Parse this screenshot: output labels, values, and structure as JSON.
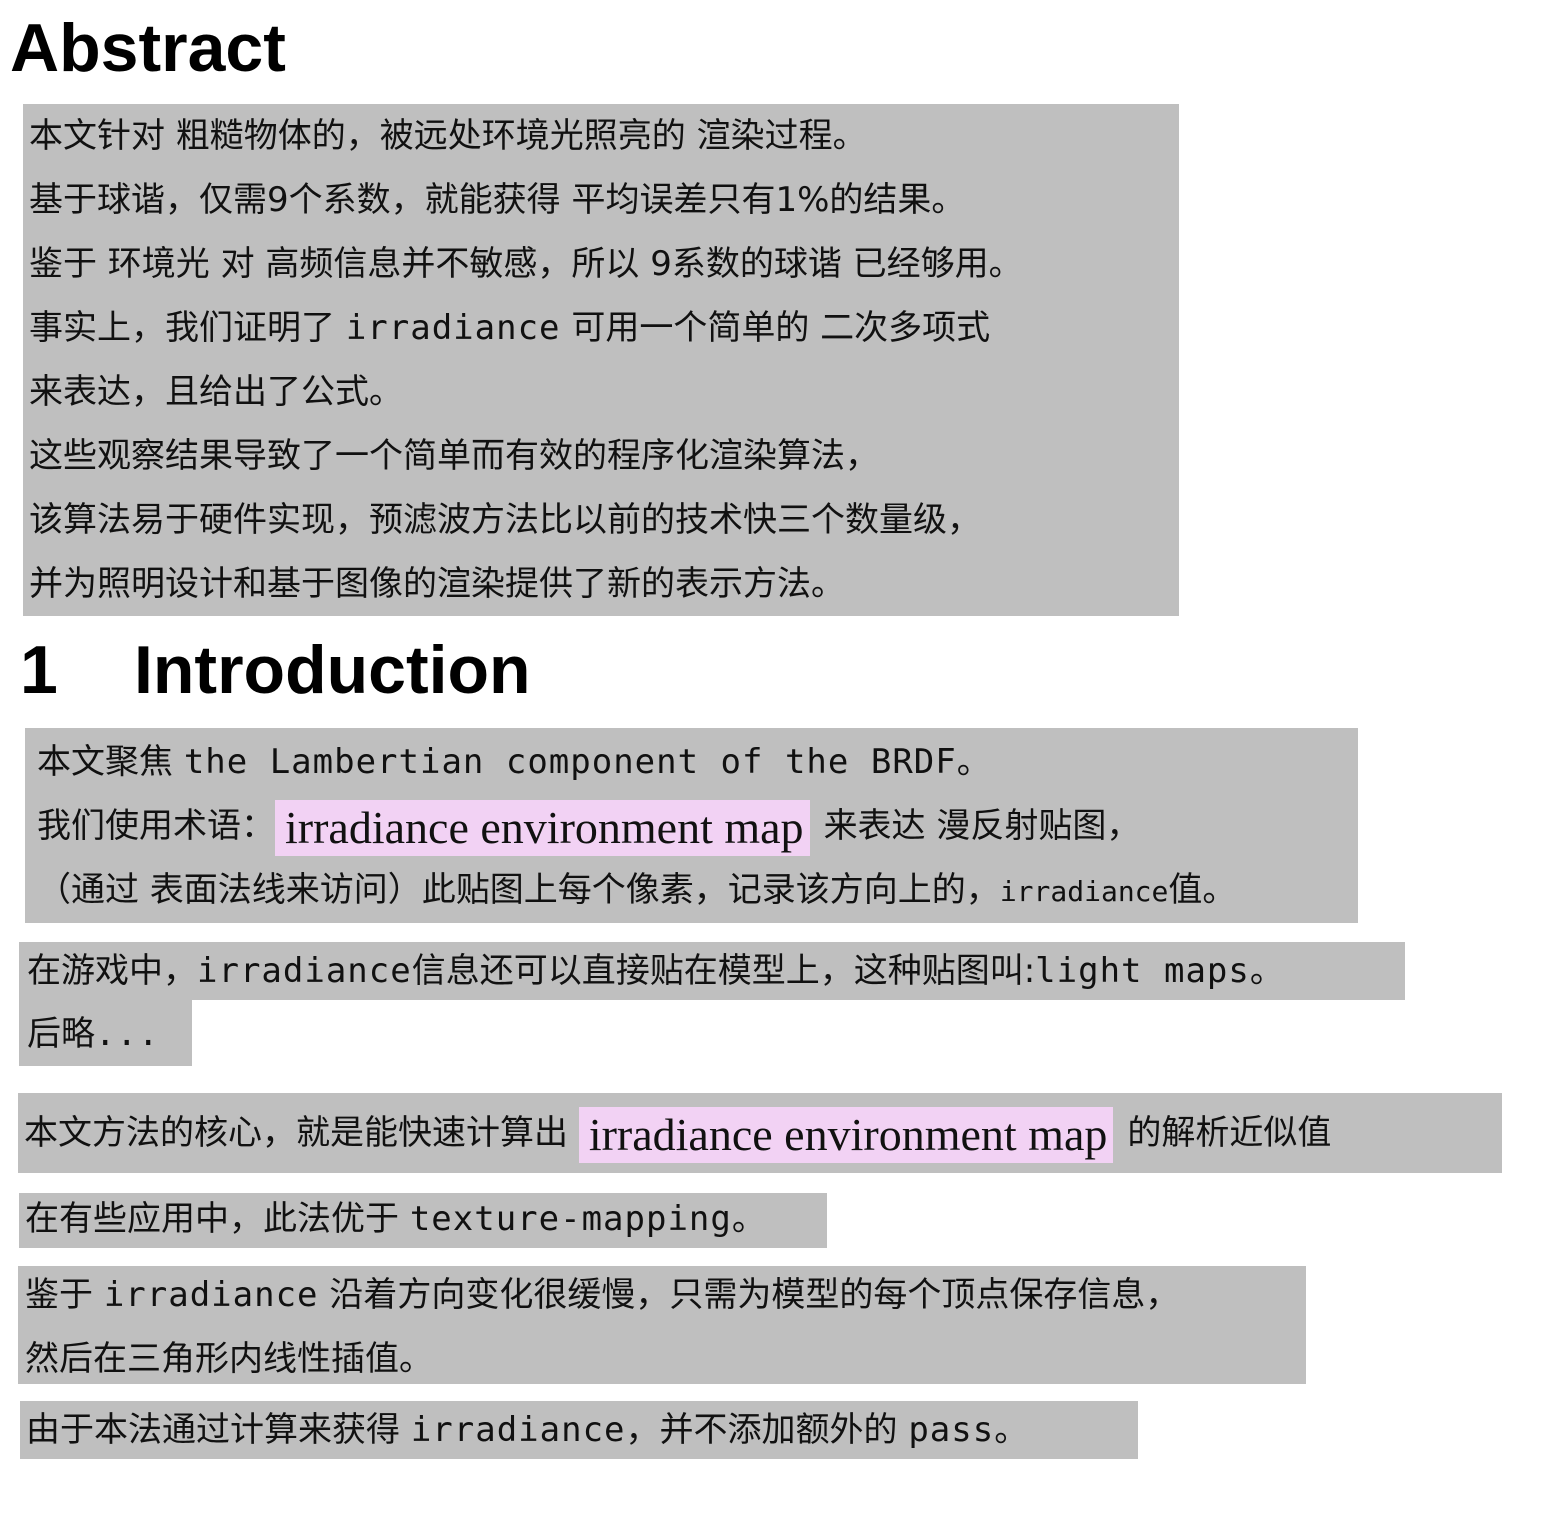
{
  "abstract": {
    "heading": "Abstract",
    "lines": [
      "本文针对 粗糙物体的，被远处环境光照亮的 渲染过程。",
      "基于球谐，仅需9个系数，就能获得 平均误差只有1%的结果。",
      "鉴于 环境光 对 高频信息并不敏感，所以 9系数的球谐 已经够用。",
      {
        "pre": "事实上，我们证明了 ",
        "code": "irradiance",
        "post": " 可用一个简单的 二次多项式"
      },
      "来表达，且给出了公式。",
      "这些观察结果导致了一个简单而有效的程序化渲染算法，",
      "该算法易于硬件实现，预滤波方法比以前的技术快三个数量级，",
      "并为照明设计和基于图像的渲染提供了新的表示方法。"
    ]
  },
  "introduction": {
    "number": "1",
    "heading": "Introduction",
    "block1": {
      "line1_pre": "本文聚焦 ",
      "line1_code": "the Lambertian component of the BRDF。",
      "line2_pre": "我们使用术语：",
      "line2_highlight": "irradiance environment map",
      "line2_post": "来表达 漫反射贴图，",
      "line3_pre": "（通过 表面法线来访问）此贴图上每个像素，记录该方向上的，",
      "line3_code": "irradiance",
      "line3_post": "值。"
    },
    "block2": {
      "line1_pre": "在游戏中，",
      "line1_code": "irradiance",
      "line1_mid": "信息还可以直接贴在模型上，这种贴图叫:",
      "line1_code2": "light maps",
      "line1_post": "。",
      "line2_pre": "后略",
      "line2_code": "..."
    },
    "block3": {
      "pre": "本文方法的核心，就是能快速计算出 ",
      "highlight": "irradiance environment map",
      "post": "的解析近似值"
    },
    "block4": {
      "pre": "在有些应用中，此法优于 ",
      "code": "texture-mapping",
      "post": "。"
    },
    "block5": {
      "line1_pre": "鉴于 ",
      "line1_code": "irradiance",
      "line1_post": " 沿着方向变化很缓慢，只需为模型的每个顶点保存信息，",
      "line2": "然后在三角形内线性插值。"
    },
    "block6": {
      "pre": "由于本法通过计算来获得 ",
      "code": "irradiance",
      "mid": "，并不添加额外的 ",
      "code2": "pass",
      "post": "。"
    }
  },
  "colors": {
    "block_background": "#bfbfbf",
    "highlight_background": "#f2d2f4",
    "heading_text": "#000000"
  }
}
